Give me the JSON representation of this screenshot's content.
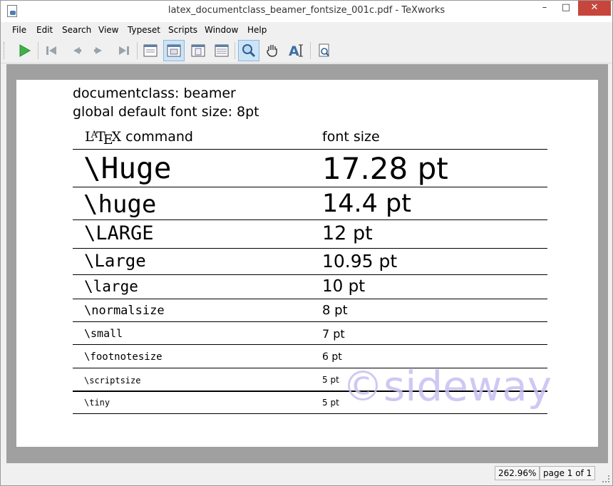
{
  "window": {
    "title": "latex_documentclass_beamer_fontsize_001c.pdf - TeXworks",
    "controls": {
      "minimize": "–",
      "maximize": "□",
      "close": "✕"
    }
  },
  "menu": [
    "File",
    "Edit",
    "Search",
    "View",
    "Typeset",
    "Scripts",
    "Window",
    "Help"
  ],
  "toolbar": {
    "buttons": [
      {
        "name": "typeset-icon",
        "active": false
      },
      {
        "name": "first-page-icon",
        "active": false
      },
      {
        "name": "previous-page-icon",
        "active": false
      },
      {
        "name": "next-page-icon",
        "active": false
      },
      {
        "name": "last-page-icon",
        "active": false
      },
      {
        "name": "single-page-icon",
        "active": false
      },
      {
        "name": "fit-width-icon",
        "active": true
      },
      {
        "name": "fit-page-icon",
        "active": false
      },
      {
        "name": "fit-window-icon",
        "active": false
      },
      {
        "name": "magnify-icon",
        "active": true
      },
      {
        "name": "hand-scroll-icon",
        "active": false
      },
      {
        "name": "select-text-icon",
        "active": false
      },
      {
        "name": "find-icon",
        "active": false
      }
    ]
  },
  "document": {
    "line1": "documentclass: beamer",
    "line2": "global default font size: 8pt",
    "header_command_suffix": "command",
    "header_size": "font size",
    "rows": [
      {
        "command": "\\Huge",
        "size": "17.28 pt"
      },
      {
        "command": "\\huge",
        "size": "14.4 pt"
      },
      {
        "command": "\\LARGE",
        "size": "12 pt"
      },
      {
        "command": "\\Large",
        "size": "10.95 pt"
      },
      {
        "command": "\\large",
        "size": "10 pt"
      },
      {
        "command": "\\normalsize",
        "size": "8 pt"
      },
      {
        "command": "\\small",
        "size": "7 pt"
      },
      {
        "command": "\\footnotesize",
        "size": "6 pt"
      },
      {
        "command": "\\scriptsize",
        "size": "5 pt"
      },
      {
        "command": "\\tiny",
        "size": "5 pt"
      }
    ],
    "watermark": "©sideway"
  },
  "status": {
    "zoom": "262.96%",
    "page": "page 1 of 1"
  }
}
